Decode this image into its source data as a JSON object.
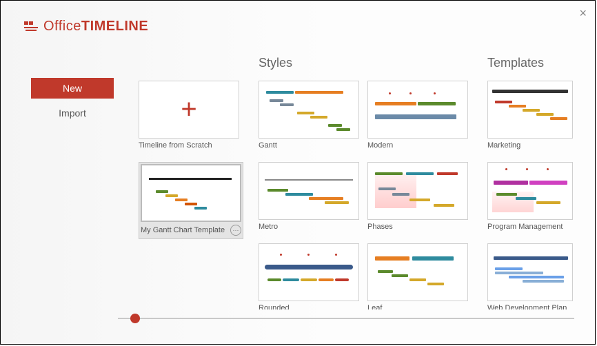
{
  "brand": {
    "prefix": "Office",
    "suffix": "TIMELINE"
  },
  "nav": {
    "new": "New",
    "import": "Import"
  },
  "sections": {
    "styles": "Styles",
    "templates": "Templates"
  },
  "scratch": [
    {
      "label": "Timeline from Scratch"
    },
    {
      "label": "My Gantt Chart Template"
    }
  ],
  "styles": [
    {
      "label": "Gantt"
    },
    {
      "label": "Modern"
    },
    {
      "label": "Metro"
    },
    {
      "label": "Phases"
    },
    {
      "label": "Rounded"
    },
    {
      "label": "Leaf"
    }
  ],
  "templates": [
    {
      "label": "Marketing"
    },
    {
      "label": "Program Management"
    },
    {
      "label": "Web Development Plan"
    }
  ],
  "colors": {
    "accent": "#c0392b",
    "orange": "#e67e22",
    "green": "#5b8a2c",
    "teal": "#2e8b9e",
    "yellow": "#d4a82a",
    "blue": "#3a5a8a",
    "magenta": "#b030a0"
  }
}
